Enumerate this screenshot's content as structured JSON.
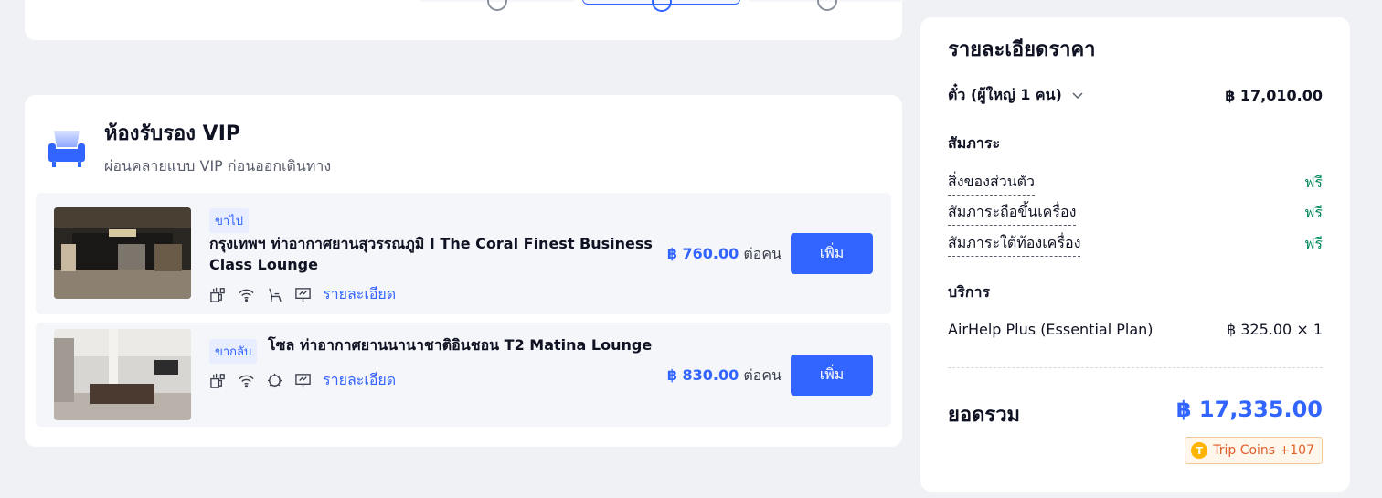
{
  "lounge": {
    "title": "ห้องรับรอง VIP",
    "subtitle": "ผ่อนคลายแบบ VIP ก่อนออกเดินทาง",
    "items": [
      {
        "tag": "ขาไป",
        "name": "กรุงเทพฯ ท่าอากาศยานสุวรรณภูมิ I The Coral Finest Business Class Lounge",
        "amenities": [
          "food-drink-icon",
          "wifi-icon",
          "seat-icon",
          "tv-icon"
        ],
        "detail_link": "รายละเอียด",
        "price": "฿ 760.00",
        "per": "ต่อคน",
        "add_label": "เพิ่ม"
      },
      {
        "tag": "ขากลับ",
        "name": "โซล ท่าอากาศยานนานาชาติอินชอน T2 Matina Lounge",
        "amenities": [
          "food-drink-icon",
          "wifi-icon",
          "no-smoking-icon",
          "tv-icon"
        ],
        "detail_link": "รายละเอียด",
        "price": "฿ 830.00",
        "per": "ต่อคน",
        "add_label": "เพิ่ม"
      }
    ]
  },
  "price_detail": {
    "title": "รายละเอียดราคา",
    "ticket_label": "ตั๋ว (ผู้ใหญ่ 1 คน)",
    "ticket_price": "฿ 17,010.00",
    "baggage_heading": "สัมภาระ",
    "baggage": [
      {
        "label": "สิ่งของส่วนตัว",
        "value": "ฟรี"
      },
      {
        "label": "สัมภาระถือขึ้นเครื่อง",
        "value": "ฟรี"
      },
      {
        "label": "สัมภาระใต้ท้องเครื่อง",
        "value": "ฟรี"
      }
    ],
    "services_heading": "บริการ",
    "service_label": "AirHelp Plus (Essential Plan)",
    "service_price": "฿ 325.00 × 1",
    "total_label": "ยอดรวม",
    "total_value": "฿ 17,335.00",
    "coins_label": "Trip Coins +107",
    "coin_letter": "T"
  },
  "colors": {
    "accent": "#3264ff",
    "free": "#00875a",
    "coins": "#e0602a"
  }
}
